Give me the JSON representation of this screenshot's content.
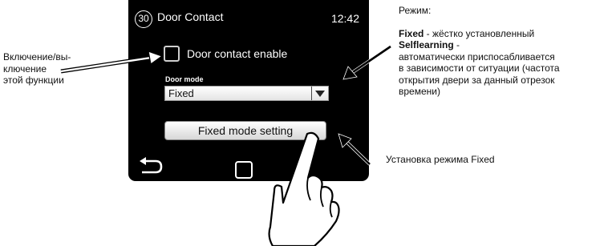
{
  "screen": {
    "badge_number": "30",
    "title": "Door Contact",
    "clock": "12:42",
    "checkbox_label": "Door contact enable",
    "checkbox_checked": false,
    "door_mode_label": "Door mode",
    "door_mode_value": "Fixed",
    "fixed_mode_button": "Fixed mode setting"
  },
  "annotations": {
    "left_line1": "Включение/вы-",
    "left_line2": "ключение",
    "left_line3": "этой функции",
    "right_heading": "Режим:",
    "fixed_term": "Fixed",
    "fixed_desc": " - жёстко установленный",
    "selflearning_term": "Selflearning",
    "selflearning_suffix": " -",
    "selflearning_line1": "автоматически приспосабливается",
    "selflearning_line2": "в зависимости от ситуации (частота",
    "selflearning_line3": "открытия двери за данный отрезок",
    "selflearning_line4": "времени)",
    "bottom_right": "Установка режима Fixed"
  },
  "icons": {
    "badge": "circle-number-icon",
    "dropdown": "dropdown-arrow-icon",
    "back": "back-arrow-icon",
    "home": "home-square-icon",
    "hand": "pointing-hand-icon"
  }
}
